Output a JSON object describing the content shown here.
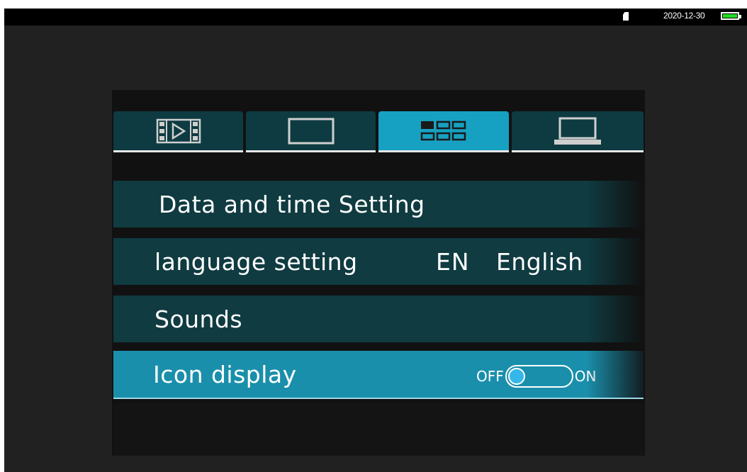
{
  "status_bar": {
    "date": "2020-12-30",
    "battery_level": 1.0,
    "battery_color": "#22dd22"
  },
  "tabs": [
    {
      "name": "media",
      "icon": "video-film-icon",
      "active": false
    },
    {
      "name": "display",
      "icon": "screen-icon",
      "active": false
    },
    {
      "name": "settings",
      "icon": "grid-menu-icon",
      "active": true
    },
    {
      "name": "system",
      "icon": "laptop-icon",
      "active": false
    }
  ],
  "menu": {
    "date_time": "Data and time Setting",
    "language": {
      "label": "language setting",
      "code": "EN",
      "name": "English"
    },
    "sounds": "Sounds",
    "icon_display": {
      "label": "Icon display",
      "off_label": "OFF",
      "on_label": "ON",
      "value": "OFF"
    }
  },
  "colors": {
    "accent": "#16a1c2",
    "row_bg": "#0f3b41",
    "knob": "#35b7ea"
  }
}
